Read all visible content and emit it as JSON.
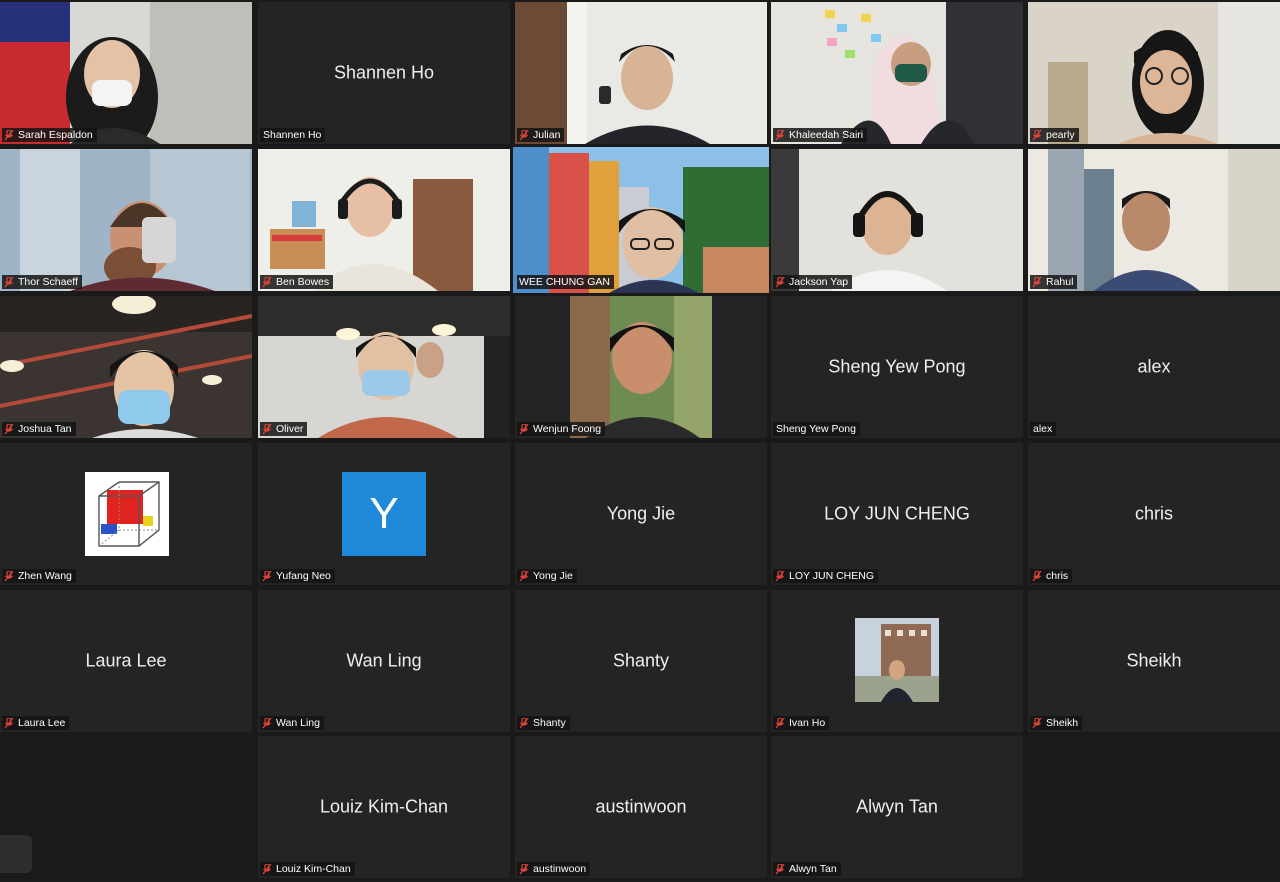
{
  "participants": [
    {
      "name": "Sarah Espaldon",
      "mode": "video"
    },
    {
      "name": "Shannen Ho",
      "mode": "name",
      "muted": false
    },
    {
      "name": "Julian",
      "mode": "video"
    },
    {
      "name": "Khaleedah Sairi",
      "mode": "video"
    },
    {
      "name": "pearly",
      "mode": "video"
    },
    {
      "name": "Thor Schaeff",
      "mode": "video"
    },
    {
      "name": "Ben Bowes",
      "mode": "video"
    },
    {
      "name": "WEE CHUNG GAN",
      "mode": "video",
      "active_speaker": true
    },
    {
      "name": "Jackson Yap",
      "mode": "video"
    },
    {
      "name": "Rahul",
      "mode": "video"
    },
    {
      "name": "Joshua Tan",
      "mode": "video"
    },
    {
      "name": "Oliver",
      "mode": "video"
    },
    {
      "name": "Wenjun Foong",
      "mode": "photo"
    },
    {
      "name": "Sheng Yew Pong",
      "mode": "name",
      "muted": false
    },
    {
      "name": "alex",
      "mode": "name",
      "muted": false
    },
    {
      "name": "Zhen Wang",
      "mode": "cube-avatar"
    },
    {
      "name": "Yufang Neo",
      "mode": "letter-avatar",
      "avatar_letter": "Y"
    },
    {
      "name": "Yong Jie",
      "mode": "name"
    },
    {
      "name": "LOY JUN CHENG",
      "mode": "name"
    },
    {
      "name": "chris",
      "mode": "name"
    },
    {
      "name": "Laura Lee",
      "mode": "name"
    },
    {
      "name": "Wan Ling",
      "mode": "name"
    },
    {
      "name": "Shanty",
      "mode": "name"
    },
    {
      "name": "Ivan Ho",
      "mode": "small-photo"
    },
    {
      "name": "Sheikh",
      "mode": "name"
    },
    {
      "name": "Louiz Kim-Chan",
      "mode": "name"
    },
    {
      "name": "austinwoon",
      "mode": "name"
    },
    {
      "name": "Alwyn Tan",
      "mode": "name"
    }
  ],
  "colors": {
    "active_speaker_border": "#d9ea84",
    "muted_icon": "#e0443a",
    "tile_bg": "#242424",
    "avatar_blue": "#1e88d9"
  }
}
